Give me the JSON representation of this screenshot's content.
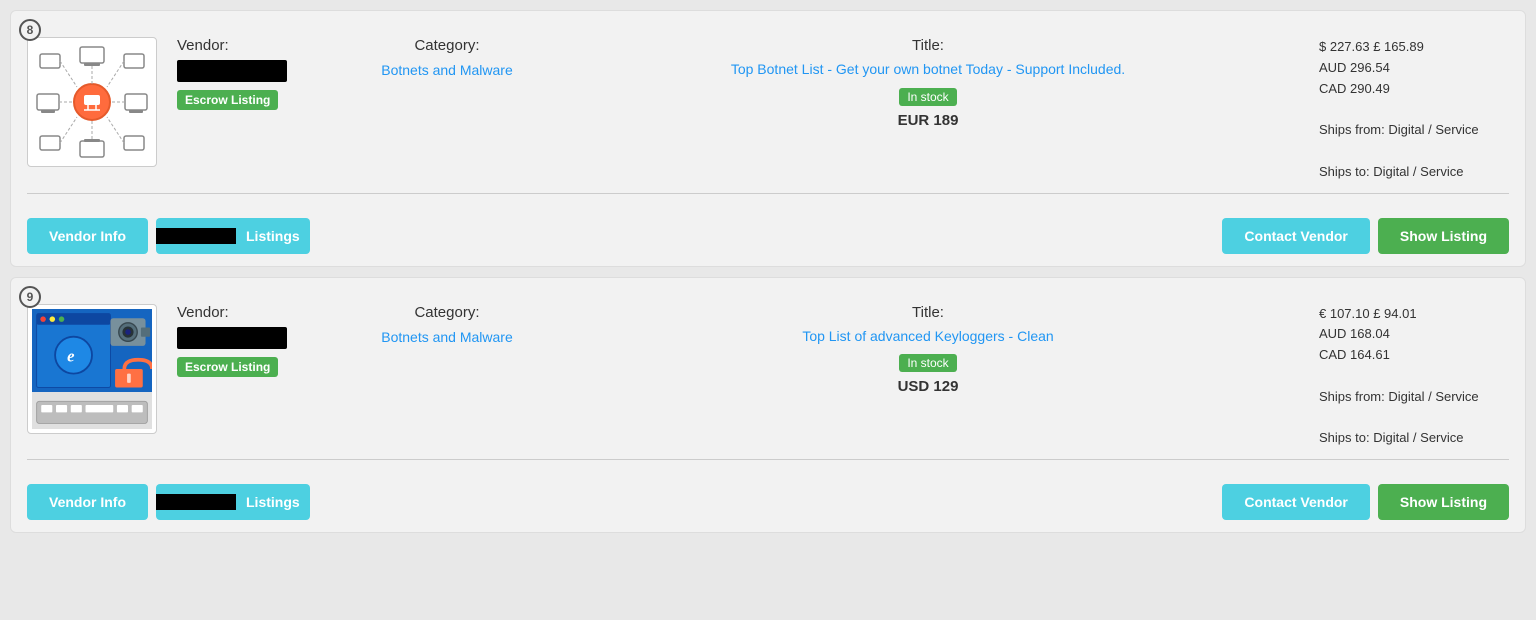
{
  "listings": [
    {
      "index": "8",
      "vendor_label": "Vendor:",
      "escrow_label": "Escrow Listing",
      "category_label": "Category:",
      "category_value": "Botnets and Malware",
      "title_label": "Title:",
      "title_value": "Top Botnet List - Get your own botnet Today - Support Included.",
      "in_stock": "In stock",
      "price_main": "EUR 189",
      "prices": "$ 227.63 £ 165.89\nAUD 296.54\nCAD 290.49",
      "ships_from": "Ships from: Digital / Service",
      "ships_to": "Ships to: Digital / Service",
      "btn_vendor_info": "Vendor Info",
      "btn_listings": "Listings",
      "btn_contact": "Contact Vendor",
      "btn_show": "Show Listing",
      "image_type": "botnet"
    },
    {
      "index": "9",
      "vendor_label": "Vendor:",
      "escrow_label": "Escrow Listing",
      "category_label": "Category:",
      "category_value": "Botnets and Malware",
      "title_label": "Title:",
      "title_value": "Top List of advanced Keyloggers - Clean",
      "in_stock": "In stock",
      "price_main": "USD 129",
      "prices": "€ 107.10 £ 94.01\nAUD 168.04\nCAD 164.61",
      "ships_from": "Ships from: Digital / Service",
      "ships_to": "Ships to: Digital / Service",
      "btn_vendor_info": "Vendor Info",
      "btn_listings": "Listings",
      "btn_contact": "Contact Vendor",
      "btn_show": "Show Listing",
      "image_type": "keylogger"
    }
  ]
}
